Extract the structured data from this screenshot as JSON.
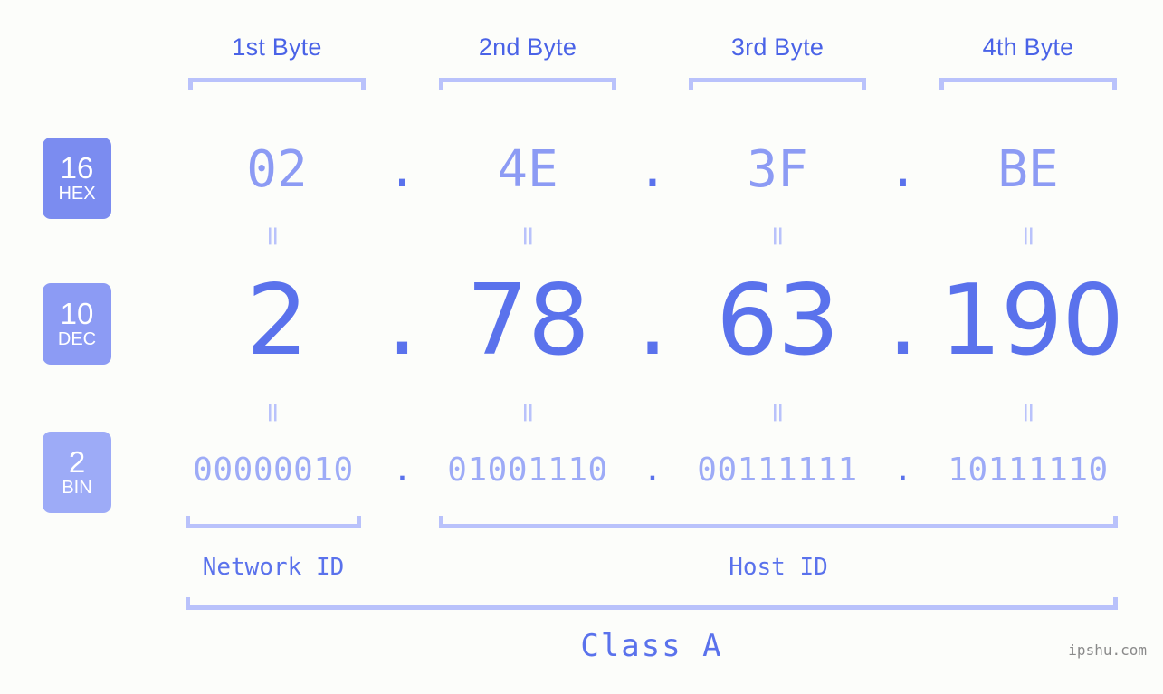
{
  "meta": {
    "background_color": "#fcfdfa",
    "accent_strong": "#5a72ec",
    "accent_mid": "#8c9bf4",
    "accent_light": "#9dabf7",
    "accent_pale": "#b9c2fb",
    "watermark": "ipshu.com"
  },
  "byte_headers": [
    {
      "label": "1st Byte"
    },
    {
      "label": "2nd Byte"
    },
    {
      "label": "3rd Byte"
    },
    {
      "label": "4th Byte"
    }
  ],
  "radix_badges": [
    {
      "number": "16",
      "name": "HEX",
      "color": "#7b8cf0"
    },
    {
      "number": "10",
      "name": "DEC",
      "color": "#8c9bf4"
    },
    {
      "number": "2",
      "name": "BIN",
      "color": "#9dabf7"
    }
  ],
  "rows": {
    "hex": {
      "radix": "16",
      "radix_name": "HEX",
      "values": [
        "02",
        "4E",
        "3F",
        "BE"
      ],
      "separator": "."
    },
    "dec": {
      "radix": "10",
      "radix_name": "DEC",
      "values": [
        "2",
        "78",
        "63",
        "190"
      ],
      "separator": "."
    },
    "bin": {
      "radix": "2",
      "radix_name": "BIN",
      "values": [
        "00000010",
        "01001110",
        "00111111",
        "10111110"
      ],
      "separator": "."
    }
  },
  "equals_marks": {
    "glyph": "=",
    "hex_to_dec_count": 4,
    "dec_to_bin_count": 4
  },
  "sections": [
    {
      "label": "Network ID"
    },
    {
      "label": "Host ID"
    }
  ],
  "class": {
    "label": "Class A"
  }
}
